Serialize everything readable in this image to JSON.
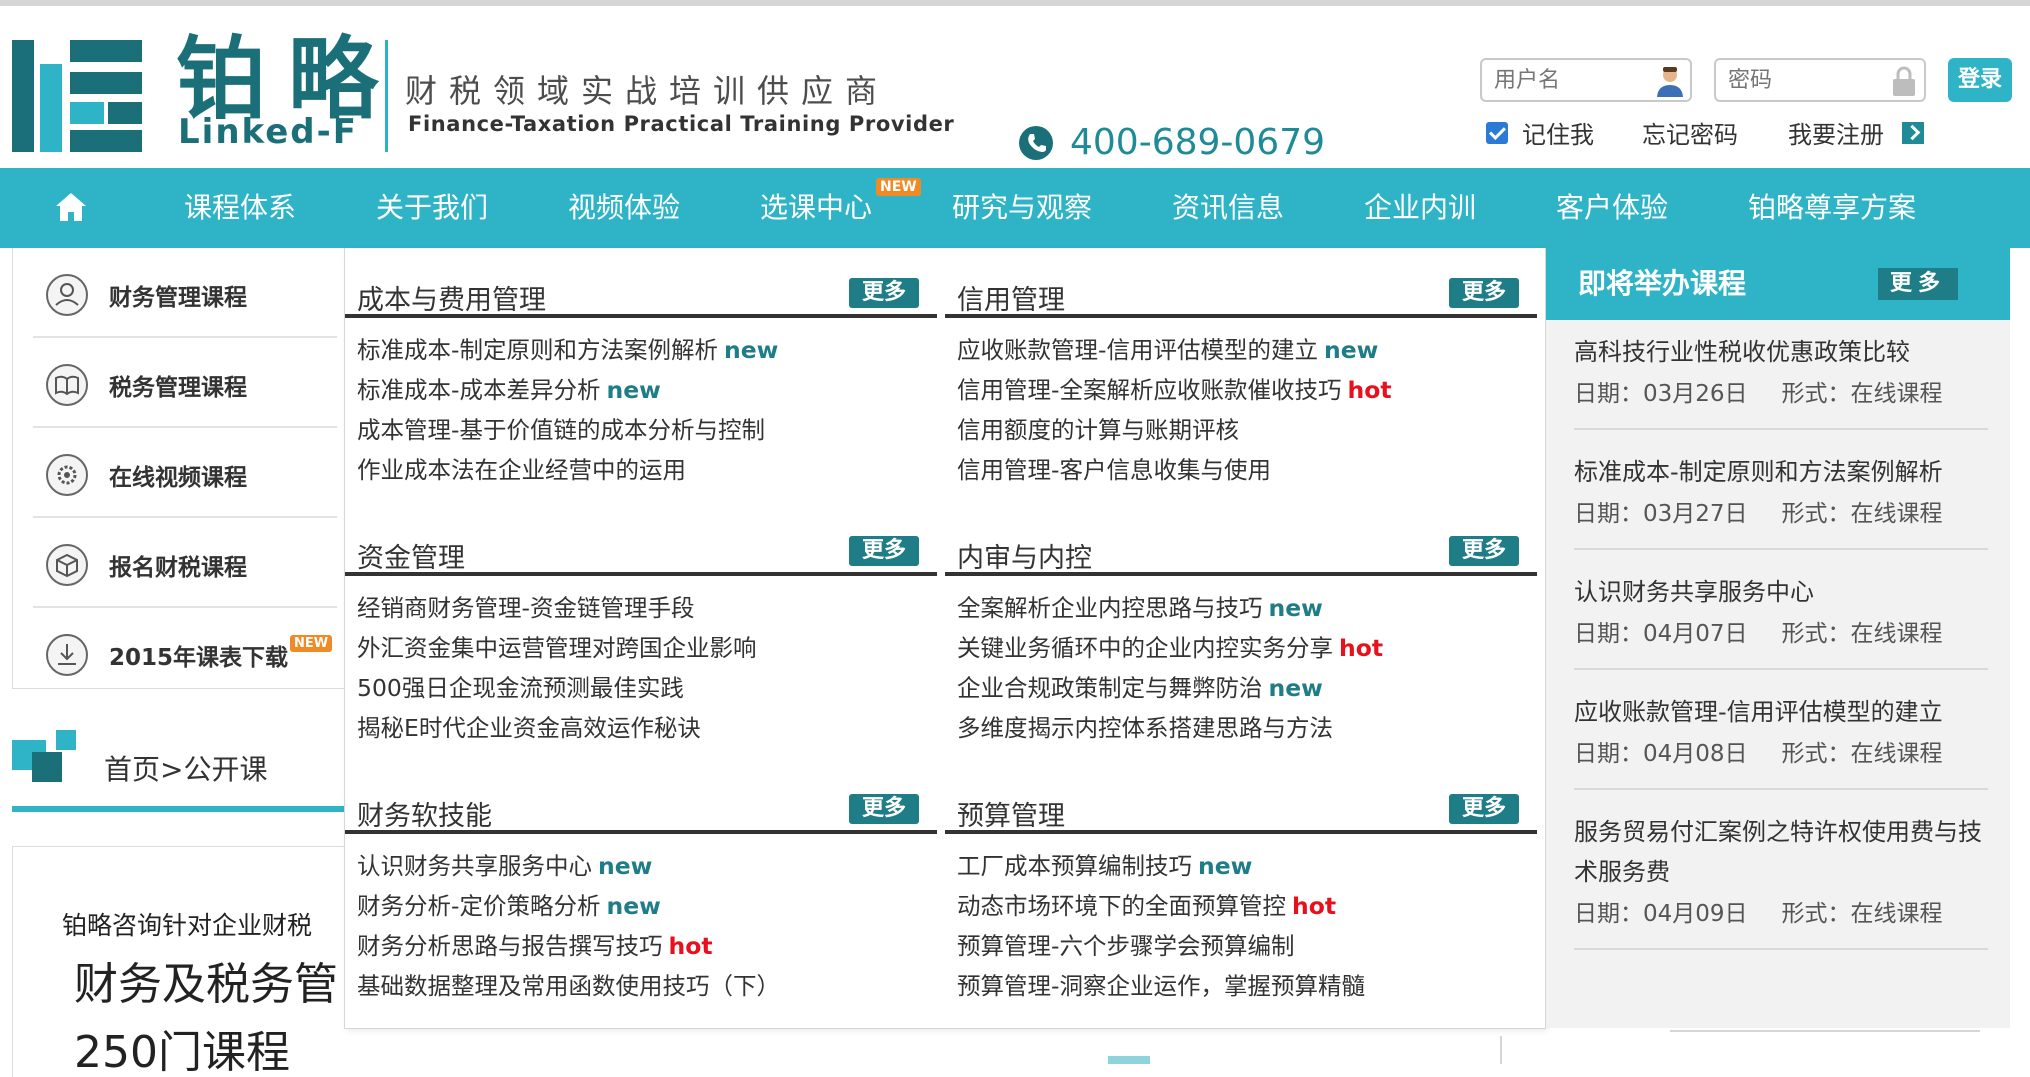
{
  "header": {
    "logo_cn": "铂略",
    "logo_en": "Linked-F",
    "slogan_cn": "财税领域实战培训供应商",
    "slogan_en": "Finance-Taxation Practical Training Provider",
    "phone": "400-689-0679"
  },
  "login": {
    "username_placeholder": "用户名",
    "password_placeholder": "密码",
    "login_label": "登录",
    "remember_label": "记住我",
    "forgot_label": "忘记密码",
    "register_label": "我要注册"
  },
  "nav": {
    "items": [
      "课程体系",
      "关于我们",
      "视频体验",
      "选课中心",
      "研究与观察",
      "资讯信息",
      "企业内训",
      "客户体验",
      "铂略尊享方案"
    ],
    "new_badge": "NEW"
  },
  "sidebar": {
    "items": [
      "财务管理课程",
      "税务管理课程",
      "在线视频课程",
      "报名财税课程",
      "2015年课表下载"
    ],
    "new_badge": "NEW"
  },
  "breadcrumb": "首页>公开课",
  "intro": {
    "small": "铂略咨询针对企业财税",
    "big": "财务及税务管",
    "big2": "250门课程"
  },
  "more_label": "更多",
  "tags": {
    "new": "new",
    "hot": "hot"
  },
  "categories": [
    {
      "title": "成本与费用管理",
      "courses": [
        {
          "name": "标准成本-制定原则和方法案例解析",
          "tag": "new"
        },
        {
          "name": "标准成本-成本差异分析",
          "tag": "new"
        },
        {
          "name": "成本管理-基于价值链的成本分析与控制",
          "tag": ""
        },
        {
          "name": "作业成本法在企业经营中的运用",
          "tag": ""
        }
      ]
    },
    {
      "title": "信用管理",
      "courses": [
        {
          "name": "应收账款管理-信用评估模型的建立",
          "tag": "new"
        },
        {
          "name": "信用管理-全案解析应收账款催收技巧",
          "tag": "hot"
        },
        {
          "name": "信用额度的计算与账期评核",
          "tag": ""
        },
        {
          "name": "信用管理-客户信息收集与使用",
          "tag": ""
        }
      ]
    },
    {
      "title": "资金管理",
      "courses": [
        {
          "name": "经销商财务管理-资金链管理手段",
          "tag": ""
        },
        {
          "name": "外汇资金集中运营管理对跨国企业影响",
          "tag": ""
        },
        {
          "name": "500强日企现金流预测最佳实践",
          "tag": ""
        },
        {
          "name": "揭秘E时代企业资金高效运作秘诀",
          "tag": ""
        }
      ]
    },
    {
      "title": "内审与内控",
      "courses": [
        {
          "name": "全案解析企业内控思路与技巧",
          "tag": "new"
        },
        {
          "name": "关键业务循环中的企业内控实务分享",
          "tag": "hot"
        },
        {
          "name": "企业合规政策制定与舞弊防治",
          "tag": "new"
        },
        {
          "name": "多维度揭示内控体系搭建思路与方法",
          "tag": ""
        }
      ]
    },
    {
      "title": "财务软技能",
      "courses": [
        {
          "name": "认识财务共享服务中心",
          "tag": "new"
        },
        {
          "name": "财务分析-定价策略分析",
          "tag": "new"
        },
        {
          "name": "财务分析思路与报告撰写技巧",
          "tag": "hot"
        },
        {
          "name": "基础数据整理及常用函数使用技巧（下）",
          "tag": ""
        }
      ]
    },
    {
      "title": "预算管理",
      "courses": [
        {
          "name": "工厂成本预算编制技巧",
          "tag": "new"
        },
        {
          "name": "动态市场环境下的全面预算管控",
          "tag": "hot"
        },
        {
          "name": "预算管理-六个步骤学会预算编制",
          "tag": ""
        },
        {
          "name": "预算管理-洞察企业运作，掌握预算精髓",
          "tag": ""
        }
      ]
    }
  ],
  "upcoming": {
    "title": "即将举办课程",
    "more": "更多",
    "items": [
      {
        "name": "高科技行业性税收优惠政策比较",
        "date": "日期：03月26日",
        "form": "形式：在线课程"
      },
      {
        "name": "标准成本-制定原则和方法案例解析",
        "date": "日期：03月27日",
        "form": "形式：在线课程"
      },
      {
        "name": "认识财务共享服务中心",
        "date": "日期：04月07日",
        "form": "形式：在线课程"
      },
      {
        "name": "应收账款管理-信用评估模型的建立",
        "date": "日期：04月08日",
        "form": "形式：在线课程"
      },
      {
        "name": "服务贸易付汇案例之特许权使用费与技术服务费",
        "date": "日期：04月09日",
        "form": "形式：在线课程"
      }
    ]
  },
  "colors": {
    "accent": "#2fb4c7",
    "dark_teal": "#1f7d88",
    "hot": "#e8101c"
  }
}
